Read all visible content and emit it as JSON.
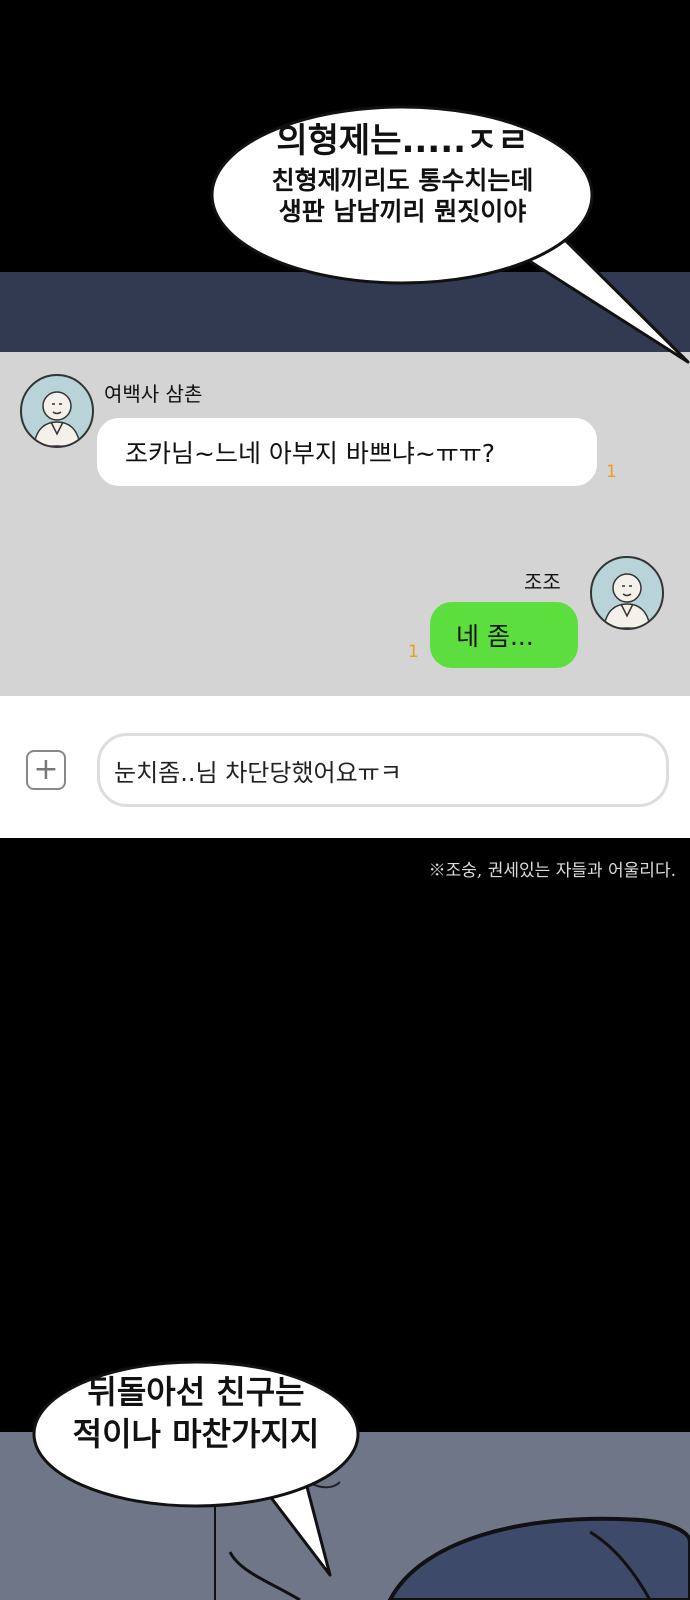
{
  "top_speech": {
    "line1": "의형제는.....ㅈㄹ",
    "line2": "친형제끼리도 통수치는데",
    "line3": "생판 남남끼리 뭔짓이야"
  },
  "chat": {
    "incoming": {
      "sender": "여백사 삼촌",
      "message": "조카님~느네 아부지 바쁘냐~ㅠㅠ?",
      "read_count": "1"
    },
    "outgoing": {
      "sender": "조조",
      "message": "네 좀...",
      "read_count": "1"
    },
    "input": {
      "value": "눈치좀..님 차단당했어요ㅠㅋ",
      "plus_icon": "plus-square-icon"
    }
  },
  "footnote": "※조숭, 권세있는 자들과 어울리다.",
  "bottom_speech": {
    "line1": "뒤돌아선 친구는",
    "line2": "적이나 마찬가지지"
  },
  "colors": {
    "chat_background": "#d4d4d4",
    "incoming_bubble": "#ffffff",
    "outgoing_bubble": "#5bde3e",
    "read_count": "#e8a21a",
    "navy_band": "#323a52"
  }
}
